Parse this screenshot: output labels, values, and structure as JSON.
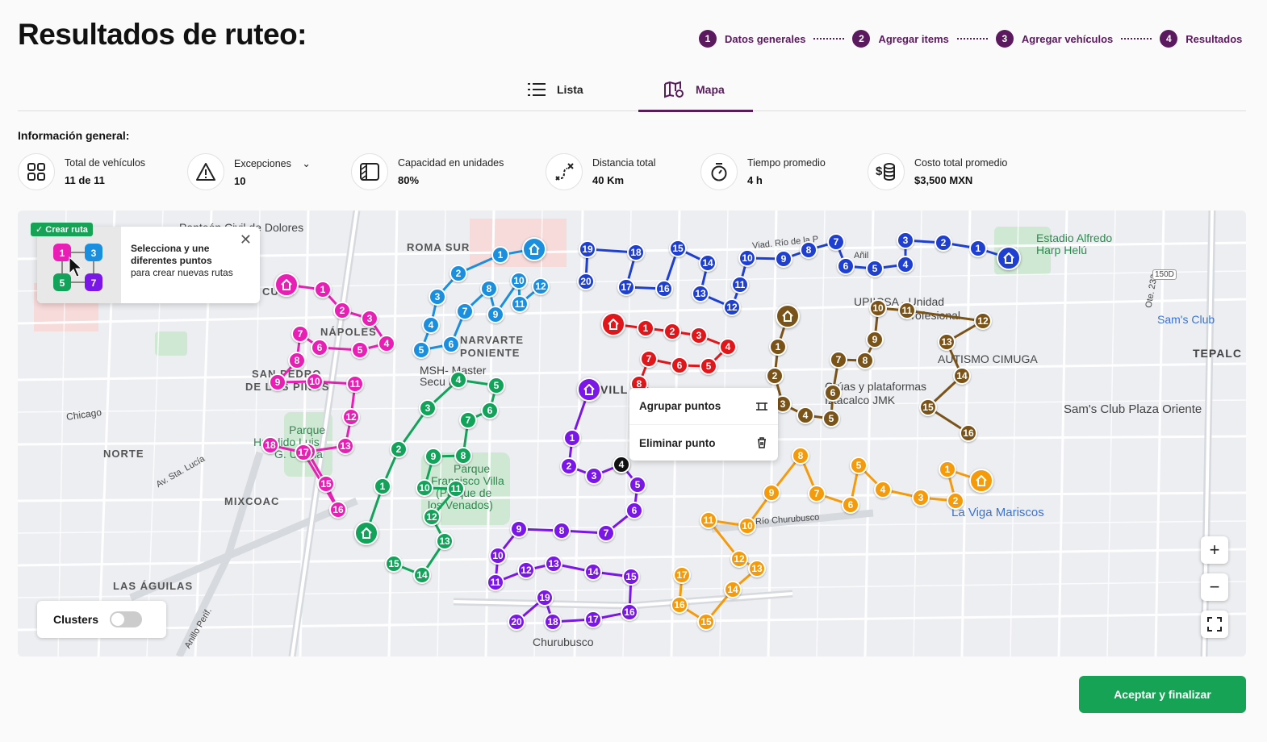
{
  "header": {
    "title": "Resultados de ruteo:"
  },
  "stepper": [
    {
      "num": "1",
      "label": "Datos generales"
    },
    {
      "num": "2",
      "label": "Agregar items"
    },
    {
      "num": "3",
      "label": "Agregar vehículos"
    },
    {
      "num": "4",
      "label": "Resultados"
    }
  ],
  "tabs": {
    "list": "Lista",
    "map": "Mapa"
  },
  "info": {
    "title": "Información general:",
    "metrics": [
      {
        "label": "Total de vehículos",
        "value": "11 de 11",
        "icon": "grid-icon"
      },
      {
        "label": "Excepciones",
        "value": "10",
        "icon": "warning-icon"
      },
      {
        "label": "Capacidad en unidades",
        "value": "80%",
        "icon": "capacity-icon"
      },
      {
        "label": "Distancia total",
        "value": "40 Km",
        "icon": "route-distance-icon"
      },
      {
        "label": "Tiempo promedio",
        "value": "4 h",
        "icon": "stopwatch-icon"
      },
      {
        "label": "Costo total promedio",
        "value": "$3,500 MXN",
        "icon": "coins-icon"
      }
    ]
  },
  "map": {
    "tooltip": {
      "badge": "✓ Crear ruta",
      "bold": "Selecciona y une diferentes puntos",
      "text": "para crear nuevas rutas"
    },
    "context_menu": {
      "group": "Agrupar puntos",
      "delete": "Eliminar punto"
    },
    "clusters_label": "Clusters",
    "places": [
      "ROMA SUR",
      "NÁPOLES",
      "NARVARTE",
      "PONIENTE",
      "SAN PEDRO",
      "DE LOS PINOS",
      "NORTE",
      "MIXCOAC",
      "LAS ÁGUILAS",
      "CULA"
    ],
    "pois": [
      "Panteón Civil de Dolores",
      "Estadio Alfredo",
      "Harp Helú",
      "Sam's Club",
      "TEPALC",
      "AUTISMO CIMUGA",
      "Sam's Club Plaza Oriente",
      "La Viga Mariscos",
      "MSH- Master",
      "Secu Ho",
      "Parque",
      "Francisco Villa",
      "(Parque de",
      "los Venados)",
      "Parque",
      "Hundido Luis",
      "G. Urbina",
      "Churubusco",
      "Av. Río Churubusco",
      "Chicago",
      "Av. Sta. Lucía",
      "UPIICSA - Unidad",
      "Profesional",
      "Grúas y plataformas",
      "Iztacalco JMK",
      "Añil",
      "Ote. 233",
      "Anillo Perif.",
      "VILL",
      "150D",
      "Viad. Río de la P"
    ],
    "route_colors": {
      "magenta": "#e91eb5",
      "lightblue": "#1a8fe0",
      "darkblue": "#1f3fd0",
      "red": "#e0161b",
      "brown": "#7a5318",
      "green": "#12a35a",
      "purple": "#7a16e8",
      "orange": "#f59a0a"
    }
  },
  "controls": {
    "zoom_in": "+",
    "zoom_out": "−"
  },
  "footer": {
    "finish": "Aceptar y finalizar"
  }
}
